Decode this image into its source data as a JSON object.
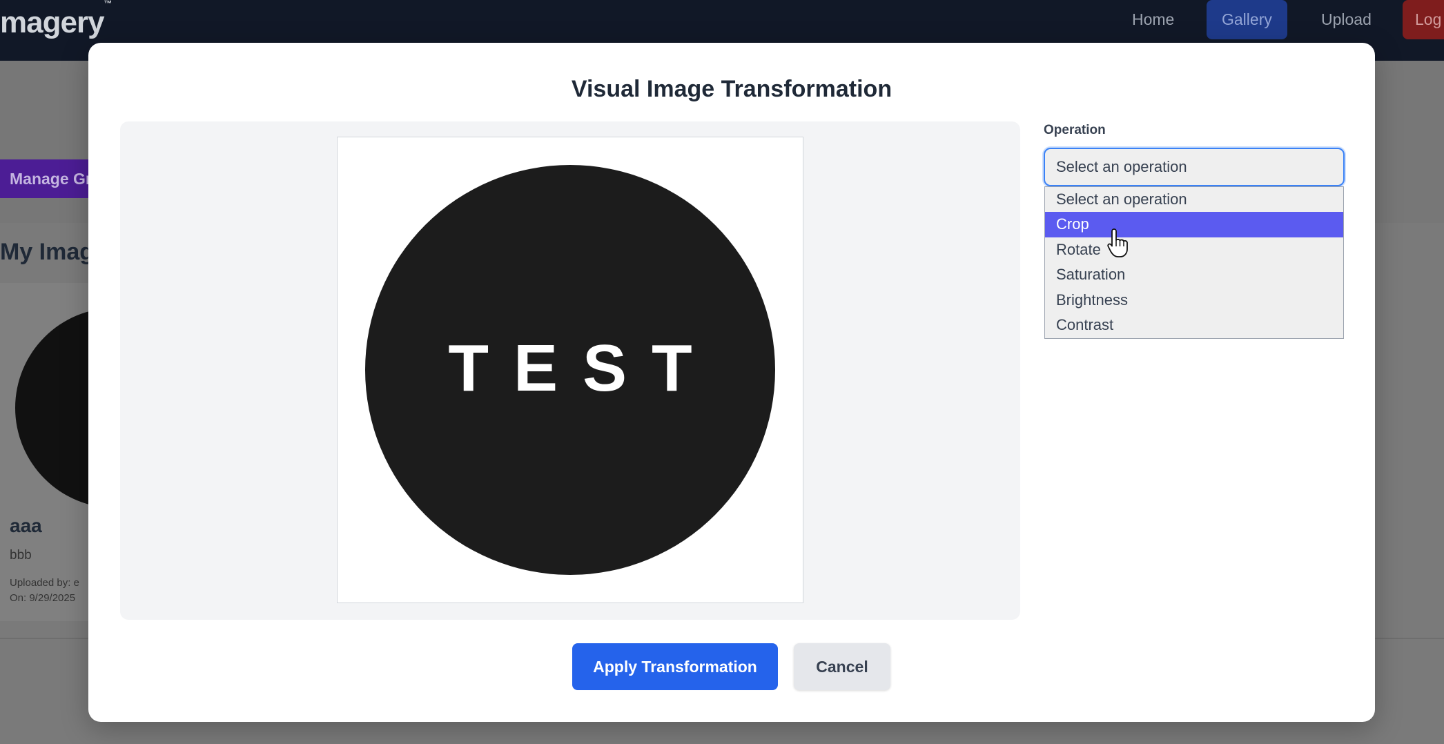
{
  "navbar": {
    "brand": "magery",
    "brand_mark": "™",
    "links": {
      "home": "Home",
      "gallery": "Gallery",
      "upload": "Upload",
      "logout": "Log"
    }
  },
  "background": {
    "manage_button": "Manage Gr",
    "section_title": "My Imag",
    "card": {
      "title": "aaa",
      "description": "bbb",
      "uploaded_by": "Uploaded by: e",
      "uploaded_on": "On: 9/29/2025"
    }
  },
  "modal": {
    "title": "Visual Image Transformation",
    "preview_text": "TEST",
    "operation": {
      "label": "Operation",
      "selected_value": "Select an operation",
      "options": [
        "Select an operation",
        "Crop",
        "Rotate",
        "Saturation",
        "Brightness",
        "Contrast"
      ],
      "highlighted": "Crop"
    },
    "apply_label": "Apply Transformation",
    "cancel_label": "Cancel"
  },
  "colors": {
    "navbar_bg": "#111827",
    "primary": "#2563eb",
    "highlight": "#5b5bf0",
    "focus_ring": "#3b82f6"
  }
}
